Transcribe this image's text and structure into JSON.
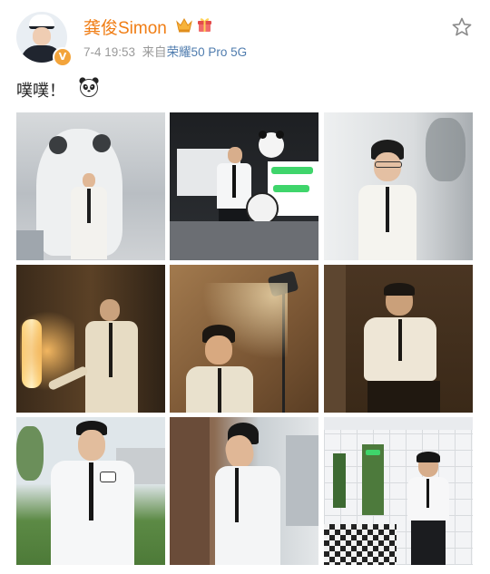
{
  "post": {
    "author": "龚俊Simon",
    "time": "7-4 19:53",
    "source_prefix": "来自",
    "device": "荣耀50 Pro 5G",
    "text": "噗噗！",
    "verified_badge": "V"
  },
  "icons": {
    "avatar": "avatar",
    "verified": "verified-badge-icon",
    "vip": "crown-icon",
    "gift": "gift-icon",
    "favorite": "star-icon",
    "emoji": "panda-emoji-icon"
  },
  "colors": {
    "author": "#f07d14",
    "device": "#4f7cae",
    "meta": "#9a9a9a",
    "text": "#222222"
  },
  "photos": [
    {
      "id": 1,
      "scene": "white suit with panda statue"
    },
    {
      "id": 2,
      "scene": "white shirt holding panda cushion, green neon sign"
    },
    {
      "id": 3,
      "scene": "white suit, glasses, bright background"
    },
    {
      "id": 4,
      "scene": "warm light, touching lamp"
    },
    {
      "id": 5,
      "scene": "warm spotlight portrait"
    },
    {
      "id": 6,
      "scene": "seated in white suit, brown backdrop"
    },
    {
      "id": 7,
      "scene": "white shirt outdoors in grass"
    },
    {
      "id": 8,
      "scene": "looking up, white shirt, city buildings"
    },
    {
      "id": 9,
      "scene": "white tiled corridor with checkered floor"
    }
  ]
}
